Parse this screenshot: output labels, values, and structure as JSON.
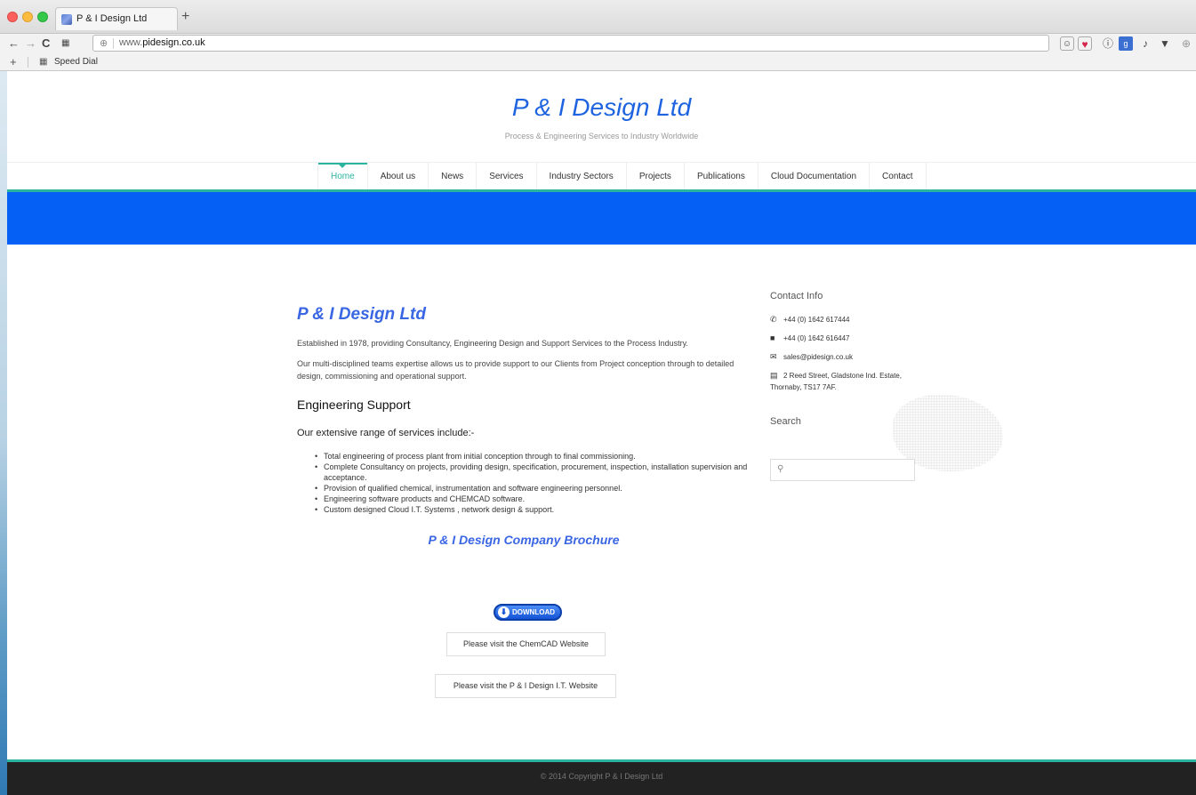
{
  "browser": {
    "tab_title": "P & I Design Ltd",
    "new_tab_label": "+",
    "url_prefix": "www.",
    "url_host": "pidesign.co.uk",
    "bookmark_add_label": "+",
    "bookmark_label": "Speed Dial"
  },
  "header": {
    "site_title": "P & I Design Ltd",
    "tagline": "Process & Engineering Services to Industry Worldwide"
  },
  "nav": {
    "items": [
      {
        "label": "Home",
        "active": true
      },
      {
        "label": "About us"
      },
      {
        "label": "News"
      },
      {
        "label": "Services"
      },
      {
        "label": "Industry Sectors"
      },
      {
        "label": "Projects"
      },
      {
        "label": "Publications"
      },
      {
        "label": "Cloud Documentation"
      },
      {
        "label": "Contact"
      }
    ]
  },
  "colors": {
    "accent": "#2bb5a0",
    "banner": "#0561f5",
    "heading_blue": "#3a66e4"
  },
  "main": {
    "title": "P & I Design Ltd",
    "intro": "Established in 1978, providing Consultancy, Engineering Design and Support Services to the Process Industry.",
    "teams": "Our multi-disciplined teams expertise allows us to provide support to our Clients from Project conception through to detailed design, commissioning and operational support.",
    "engineering_heading": "Engineering Support",
    "services_heading": "Our extensive range of services include:-",
    "services": [
      "Total engineering of process plant from initial conception through to final commissioning.",
      "Complete Consultancy on projects, providing design, specification, procurement, inspection, installation supervision and acceptance.",
      "Provision of qualified chemical, instrumentation and software engineering personnel.",
      "Engineering software products and CHEMCAD software.",
      "Custom designed Cloud I.T. Systems , network design & support."
    ],
    "brochure_heading": "P & I Design Company Brochure",
    "download_label": "DOWNLOAD",
    "chemcad_button": "Please visit the ChemCAD Website",
    "it_button": "Please visit the P & I Design I.T. Website"
  },
  "sidebar": {
    "contact_heading": "Contact Info",
    "phone": "+44 (0) 1642 617444",
    "fax": "+44 (0) 1642 616447",
    "email": "sales@pidesign.co.uk",
    "address": "2 Reed Street, Gladstone Ind. Estate, Thornaby, TS17 7AF.",
    "search_heading": "Search"
  },
  "footer": {
    "copyright": "© 2014 Copyright P & I Design Ltd"
  }
}
